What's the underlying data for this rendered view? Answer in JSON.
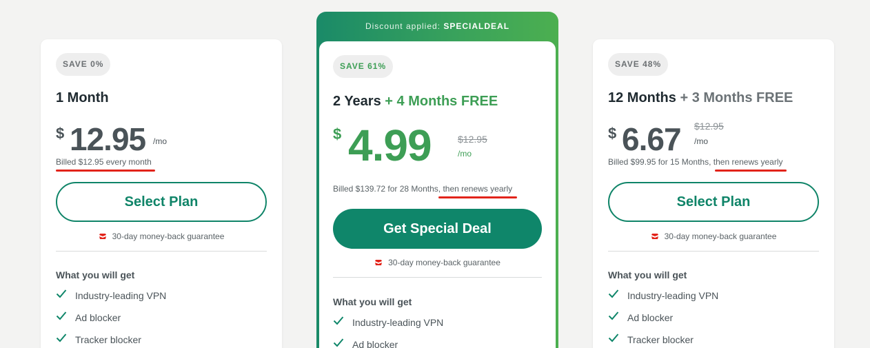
{
  "colors": {
    "brand_green": "#0f866a",
    "accent_green": "#3d9e55",
    "strike_red": "#e2231a",
    "background": "#f3f3f2"
  },
  "plans": [
    {
      "badge": "SAVE 0%",
      "title": "1 Month",
      "title_extra": "",
      "currency": "$",
      "price": "12.95",
      "per": "/mo",
      "old_price": "",
      "billed_prefix": "",
      "billed_highlight": "Billed $12.95 every month",
      "button": "Select Plan",
      "guarantee": "30-day money-back guarantee",
      "features_title": "What you will get",
      "features": [
        "Industry-leading VPN",
        "Ad blocker",
        "Tracker blocker"
      ]
    },
    {
      "banner_prefix": "Discount applied:",
      "banner_code": "SPECIALDEAL",
      "badge": "SAVE 61%",
      "title": "2 Years",
      "title_extra": "+ 4 Months FREE",
      "currency": "$",
      "price": "4.99",
      "per": "/mo",
      "old_price": "$12.95",
      "billed_prefix": "Billed $139.72 for 28 Months, ",
      "billed_highlight": "then renews yearly",
      "button": "Get Special Deal",
      "guarantee": "30-day money-back guarantee",
      "features_title": "What you will get",
      "features": [
        "Industry-leading VPN",
        "Ad blocker"
      ]
    },
    {
      "badge": "SAVE 48%",
      "title": "12 Months",
      "title_extra": "+ 3 Months FREE",
      "currency": "$",
      "price": "6.67",
      "per": "/mo",
      "old_price": "$12.95",
      "billed_prefix": "Billed $99.95 for 15 Months, ",
      "billed_highlight": "then renews yearly",
      "button": "Select Plan",
      "guarantee": "30-day money-back guarantee",
      "features_title": "What you will get",
      "features": [
        "Industry-leading VPN",
        "Ad blocker",
        "Tracker blocker"
      ]
    }
  ]
}
